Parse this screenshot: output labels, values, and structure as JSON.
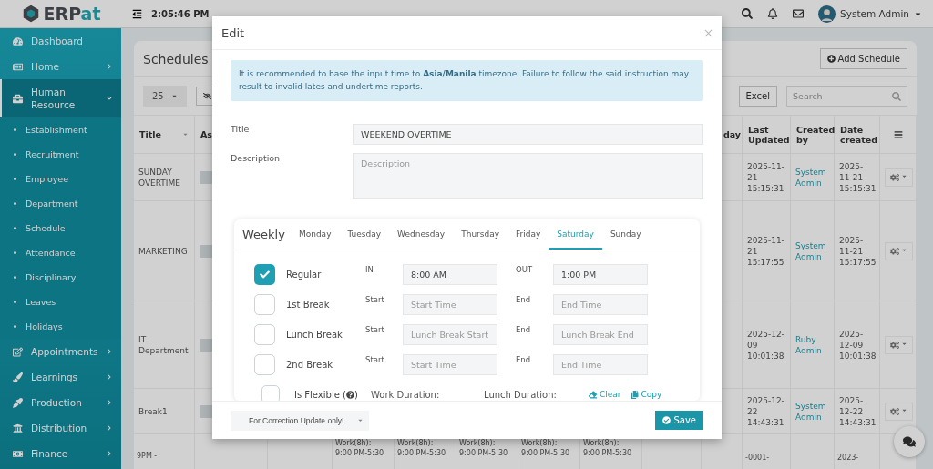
{
  "brand": {
    "name_parts": [
      "ERP",
      "at"
    ]
  },
  "topbar": {
    "time": "2:05:46 PM",
    "user": "System Admin"
  },
  "sidebar": {
    "items": [
      {
        "label": "Dashboard",
        "selected": false
      },
      {
        "label": "Home",
        "selected": false,
        "expanded": false
      },
      {
        "label": "Human Resource",
        "selected": true,
        "expanded": true,
        "children": [
          {
            "label": "Establishment"
          },
          {
            "label": "Recruitment"
          },
          {
            "label": "Employee"
          },
          {
            "label": "Department"
          },
          {
            "label": "Schedule"
          },
          {
            "label": "Attendance"
          },
          {
            "label": "Disciplinary"
          },
          {
            "label": "Leaves"
          },
          {
            "label": "Holidays"
          }
        ]
      },
      {
        "label": "Appointments",
        "selected": false,
        "expanded": false
      },
      {
        "label": "Learnings",
        "selected": false,
        "expanded": false
      },
      {
        "label": "Production",
        "selected": false,
        "expanded": false
      },
      {
        "label": "Distribution",
        "selected": false,
        "expanded": false
      },
      {
        "label": "Finance",
        "selected": false,
        "expanded": false
      }
    ]
  },
  "page": {
    "title": "Schedules",
    "add_button": "Add Schedule",
    "page_size": "25",
    "excel": "Excel",
    "search_placeholder": "Search"
  },
  "table": {
    "columns": [
      {
        "label": "Title",
        "sortable": true
      },
      {
        "label": "As"
      },
      {
        "label": "day"
      },
      {
        "label": "Last Updated"
      },
      {
        "label": "Created by"
      },
      {
        "label": "Date created"
      }
    ],
    "rows": [
      {
        "title": "SUNDAY OVERTIME",
        "last_updated": "2025-11-21 15:15:31",
        "created_by": "System Admin",
        "date_created": "2025-11-21 15:15:31"
      },
      {
        "title": "MARKETING",
        "last_updated": "2025-11-21 15:17:55",
        "created_by": "System Admin",
        "date_created": "2025-11-21 15:17:55"
      },
      {
        "title": "IT Department",
        "last_updated": "2025-12-09 10:01:38",
        "created_by": "Ruby Admin",
        "date_created": "2025-12-09 10:01:38"
      },
      {
        "title": "Break1",
        "last_updated": "2025-12-22 14:43:31",
        "created_by": "System Admin",
        "date_created": "2025-12-22 14:43:31"
      },
      {
        "title": "9PM -",
        "work": [
          {
            "label": "Work(8h):",
            "time": "9:00 PM-5:30"
          },
          {
            "label": "Work(8h):",
            "time": "9:00 PM-5:30"
          },
          {
            "label": "Work(8h):",
            "time": "9:00 PM-5:30"
          },
          {
            "label": "Work(8h):",
            "time": "9:00 PM-5:30"
          },
          {
            "label": "Work(8h):",
            "time": "9:00 PM-5:30"
          }
        ],
        "last_updated": "-0001-",
        "date_created": "2023-"
      }
    ]
  },
  "modal": {
    "title": "Edit",
    "notice": "It is recommended to base the input time to **Asia/Manila** timezone. Failure to follow the said instruction may result to invalid lates and undertime reports.",
    "fields": [
      {
        "kind": "input",
        "label": "Title",
        "value": "WEEKEND OVERTIME"
      },
      {
        "kind": "textarea",
        "label": "Description",
        "placeholder": "Description"
      }
    ],
    "schedule": {
      "title": "Weekly",
      "tabs": [
        {
          "label": "Monday",
          "selected": false
        },
        {
          "label": "Tuesday",
          "selected": false
        },
        {
          "label": "Wednesday",
          "selected": false
        },
        {
          "label": "Thursday",
          "selected": false
        },
        {
          "label": "Friday",
          "selected": false
        },
        {
          "label": "Saturday",
          "selected": true
        },
        {
          "label": "Sunday",
          "selected": false
        }
      ],
      "rows": [
        {
          "label": "Regular",
          "checked": true,
          "start_label": "IN",
          "start": {
            "value": "8:00 AM"
          },
          "end_label": "OUT",
          "end": {
            "value": "1:00 PM"
          }
        },
        {
          "label": "1st Break",
          "checked": false,
          "start_label": "Start",
          "start": {
            "placeholder": "Start Time"
          },
          "end_label": "End",
          "end": {
            "placeholder": "End Time"
          }
        },
        {
          "label": "Lunch Break",
          "checked": false,
          "start_label": "Start",
          "start": {
            "placeholder": "Lunch Break Start"
          },
          "end_label": "End",
          "end": {
            "placeholder": "Lunch Break End"
          }
        },
        {
          "label": "2nd Break",
          "checked": false,
          "start_label": "Start",
          "start": {
            "placeholder": "Start Time"
          },
          "end_label": "End",
          "end": {
            "placeholder": "End Time"
          }
        }
      ],
      "flexible": {
        "label": "Is Flexible (",
        "suffix": ")",
        "checked": false
      },
      "work_duration": "Work Duration:",
      "lunch_duration": "Lunch Duration:",
      "actions": [
        {
          "kind": "clear",
          "label": "Clear"
        },
        {
          "kind": "copy",
          "label": "Copy"
        }
      ]
    },
    "footer": {
      "select": "For Correction Update only!",
      "save": "Save"
    }
  }
}
